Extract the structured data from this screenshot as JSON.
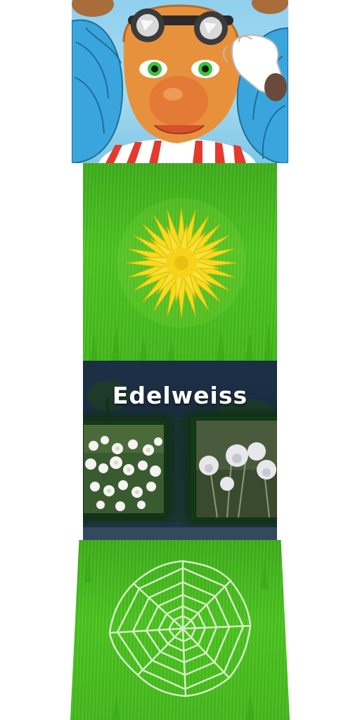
{
  "character": {
    "name": "bee-mascot",
    "colors": {
      "skin": "#e8913c",
      "eyes": "#36c23a",
      "wings": "#3ba3d8",
      "collar": "#e8332b",
      "glove": "#ffffff"
    }
  },
  "cards": [
    {
      "id": "dandelion",
      "icon": "dandelion-icon",
      "color": "#f2dc1c"
    },
    {
      "id": "spiderweb",
      "icon": "spider-web-icon",
      "color": "#d8f0c8"
    }
  ],
  "info_panel": {
    "title": "Edelweiss",
    "photos": [
      {
        "subject": "edelweiss-flowers"
      },
      {
        "subject": "white-thistle-flowers"
      }
    ]
  },
  "colors": {
    "grass": "#4cc420",
    "panel": "#1d2f44",
    "title_text": "#ffffff"
  }
}
